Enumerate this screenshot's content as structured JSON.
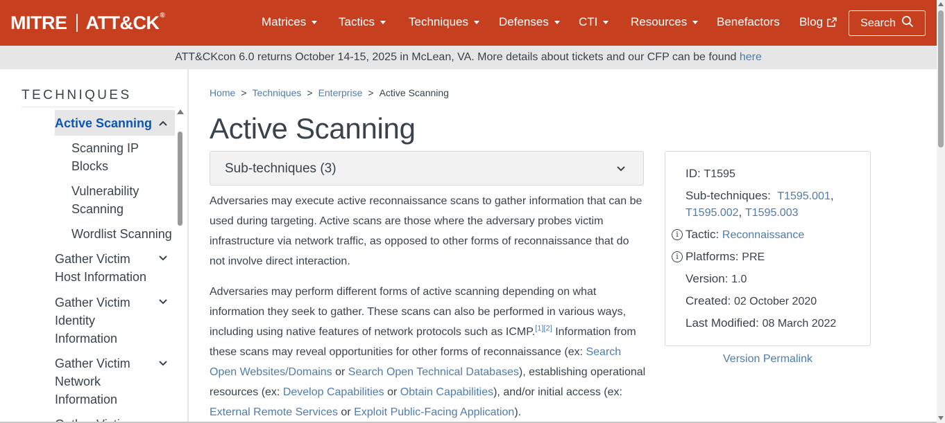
{
  "header": {
    "logo_mitre": "MITRE",
    "logo_attack": "ATT&CK",
    "logo_reg": "®",
    "nav": {
      "matrices": "Matrices",
      "tactics": "Tactics",
      "techniques": "Techniques",
      "defenses": "Defenses",
      "cti": "CTI",
      "resources": "Resources",
      "benefactors": "Benefactors",
      "blog": "Blog"
    },
    "search_label": "Search",
    "brand_color": "#c63f1f"
  },
  "banner": {
    "text": "ATT&CKcon 6.0 returns October 14-15, 2025 in McLean, VA. More details about tickets and our CFP can be found ",
    "link": "here"
  },
  "sidebar": {
    "title": "TECHNIQUES",
    "active_item": "Active Scanning",
    "subitems": [
      "Scanning IP Blocks",
      "Vulnerability Scanning",
      "Wordlist Scanning"
    ],
    "items": [
      "Gather Victim Host Information",
      "Gather Victim Identity Information",
      "Gather Victim Network Information",
      "Gather Victim"
    ]
  },
  "breadcrumb": {
    "home": "Home",
    "techniques": "Techniques",
    "enterprise": "Enterprise",
    "current": "Active Scanning",
    "separator": ">"
  },
  "main": {
    "title": "Active Scanning",
    "subtechniques_label": "Sub-techniques (3)",
    "desc1": "Adversaries may execute active reconnaissance scans to gather information that can be used during targeting. Active scans are those where the adversary probes victim infrastructure via network traffic, as opposed to other forms of reconnaissance that do not involve direct interaction.",
    "desc2": {
      "p1": "Adversaries may perform different forms of active scanning depending on what information they seek to gather. These scans can also be performed in various ways, including using native features of network protocols such as ICMP.",
      "ref1": "[1]",
      "ref2": "[2]",
      "p2": " Information from these scans may reveal opportunities for other forms of reconnaissance (ex: ",
      "link1": "Search Open Websites/Domains",
      "or1": " or ",
      "link2": "Search Open Technical Databases",
      "p3": "), establishing operational resources (ex: ",
      "link3": "Develop Capabilities",
      "or2": " or ",
      "link4": "Obtain Capabilities",
      "p4": "), and/or initial access (ex: ",
      "link5": "External Remote Services",
      "or3": " or ",
      "link6": "Exploit Public-Facing Application",
      "p5": ")."
    }
  },
  "card": {
    "id_label": "ID:",
    "id_value": "T1595",
    "subtech_label": "Sub-techniques:",
    "subtech_1": "T1595.001",
    "subtech_2": "T1595.002",
    "subtech_3": "T1595.003",
    "comma": ",",
    "tactic_label": "Tactic:",
    "tactic_value": "Reconnaissance",
    "platforms_label": "Platforms:",
    "platforms_value": "PRE",
    "version_label": "Version:",
    "version_value": "1.0",
    "created_label": "Created:",
    "created_value": "02 October 2020",
    "modified_label": "Last Modified:",
    "modified_value": "08 March 2022",
    "info_glyph": "i"
  },
  "permalink": "Version Permalink",
  "icons": {
    "caret": "caret-down-icon",
    "external": "external-link-icon",
    "search": "search-icon",
    "chevron_up": "chevron-up-icon",
    "chevron_down": "chevron-down-icon",
    "info": "info-icon"
  }
}
